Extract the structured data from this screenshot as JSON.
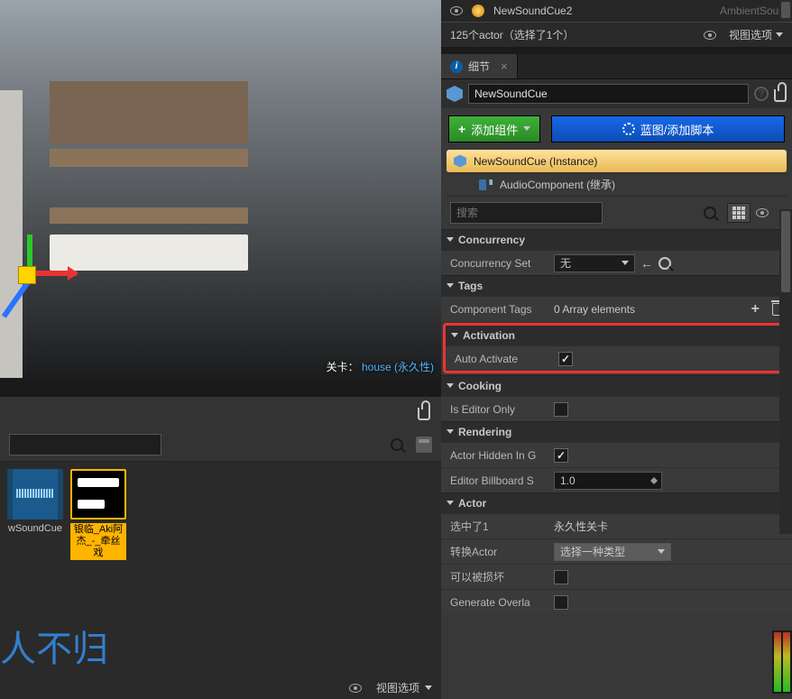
{
  "outliner": {
    "item": {
      "name": "NewSoundCue2",
      "type": "AmbientSoun"
    },
    "count_label": "125个actor（选择了1个）",
    "view_options_label": "视图选项"
  },
  "viewport": {
    "level_prefix": "关卡：",
    "level_name": "house (永久性)",
    "placed_text": "人不归"
  },
  "details": {
    "tab_label": "细节",
    "object_name": "NewSoundCue",
    "add_component_label": "添加组件",
    "blueprint_button_label": "蓝图/添加脚本",
    "components": {
      "root": "NewSoundCue (Instance)",
      "child": "AudioComponent (继承)"
    },
    "search_placeholder": "搜索",
    "sections": {
      "concurrency": {
        "title": "Concurrency",
        "concurrency_set_label": "Concurrency Set",
        "concurrency_set_value": "无"
      },
      "tags": {
        "title": "Tags",
        "component_tags_label": "Component Tags",
        "component_tags_value": "0 Array elements"
      },
      "activation": {
        "title": "Activation",
        "auto_activate_label": "Auto Activate",
        "auto_activate_checked": true
      },
      "cooking": {
        "title": "Cooking",
        "is_editor_only_label": "Is Editor Only",
        "is_editor_only_checked": false
      },
      "rendering": {
        "title": "Rendering",
        "actor_hidden_label": "Actor Hidden In G",
        "actor_hidden_checked": true,
        "billboard_label": "Editor Billboard S",
        "billboard_value": "1.0"
      },
      "actor": {
        "title": "Actor",
        "selected_label": "选中了1",
        "selected_value": "永久性关卡",
        "convert_label": "转换Actor",
        "convert_value": "选择一种类型",
        "can_be_damaged_label": "可以被损坏",
        "can_be_damaged_checked": false,
        "generate_overlap_label": "Generate Overla",
        "generate_overlap_checked": false
      }
    }
  },
  "assets": {
    "items": [
      {
        "label": "wSoundCue"
      },
      {
        "label": "银临_Aki阿杰_-_牵丝戏"
      }
    ],
    "view_options_label": "视图选项"
  }
}
